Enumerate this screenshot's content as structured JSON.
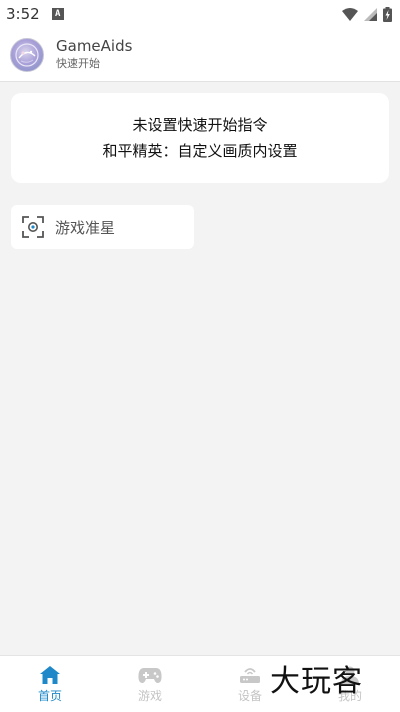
{
  "status_bar": {
    "time": "3:52",
    "app_indicator": "A"
  },
  "header": {
    "title": "GameAids",
    "subtitle": "快速开始"
  },
  "notice": {
    "line1": "未设置快速开始指令",
    "line2": "和平精英：自定义画质内设置"
  },
  "aim": {
    "label": "游戏准星"
  },
  "nav": {
    "items": [
      {
        "label": "首页",
        "icon": "home-icon",
        "active": true
      },
      {
        "label": "游戏",
        "icon": "gamepad-icon",
        "active": false
      },
      {
        "label": "设备",
        "icon": "router-icon",
        "active": false
      },
      {
        "label": "我的",
        "icon": "profile-icon",
        "active": false
      }
    ]
  },
  "watermark": "大玩客",
  "colors": {
    "accent": "#1e88c8",
    "inactive": "#c4c4c4",
    "background": "#f3f3f3"
  }
}
